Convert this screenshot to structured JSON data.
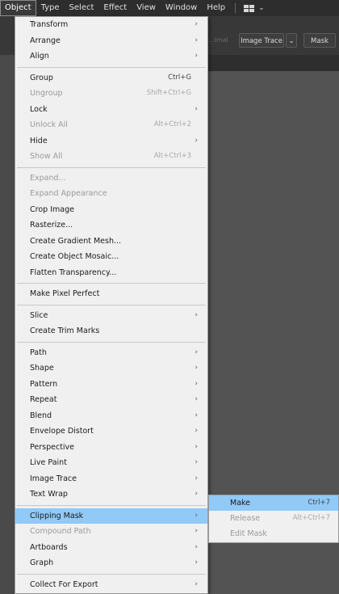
{
  "menubar": {
    "items": [
      "Object",
      "Type",
      "Select",
      "Effect",
      "View",
      "Window",
      "Help"
    ]
  },
  "controlbar": {
    "faded_label": "...imal",
    "image_trace_label": "Image Trace",
    "mask_label": "Mask"
  },
  "object_menu": {
    "items": [
      {
        "label": "Transform",
        "submenu": true
      },
      {
        "label": "Arrange",
        "submenu": true
      },
      {
        "label": "Align",
        "submenu": true
      },
      {
        "sep": true
      },
      {
        "label": "Group",
        "shortcut": "Ctrl+G"
      },
      {
        "label": "Ungroup",
        "shortcut": "Shift+Ctrl+G",
        "disabled": true
      },
      {
        "label": "Lock",
        "submenu": true
      },
      {
        "label": "Unlock All",
        "shortcut": "Alt+Ctrl+2",
        "disabled": true
      },
      {
        "label": "Hide",
        "submenu": true
      },
      {
        "label": "Show All",
        "shortcut": "Alt+Ctrl+3",
        "disabled": true
      },
      {
        "sep": true
      },
      {
        "label": "Expand...",
        "disabled": true
      },
      {
        "label": "Expand Appearance",
        "disabled": true
      },
      {
        "label": "Crop Image"
      },
      {
        "label": "Rasterize..."
      },
      {
        "label": "Create Gradient Mesh..."
      },
      {
        "label": "Create Object Mosaic..."
      },
      {
        "label": "Flatten Transparency..."
      },
      {
        "sep": true
      },
      {
        "label": "Make Pixel Perfect"
      },
      {
        "sep": true
      },
      {
        "label": "Slice",
        "submenu": true
      },
      {
        "label": "Create Trim Marks"
      },
      {
        "sep": true
      },
      {
        "label": "Path",
        "submenu": true
      },
      {
        "label": "Shape",
        "submenu": true
      },
      {
        "label": "Pattern",
        "submenu": true
      },
      {
        "label": "Repeat",
        "submenu": true
      },
      {
        "label": "Blend",
        "submenu": true
      },
      {
        "label": "Envelope Distort",
        "submenu": true
      },
      {
        "label": "Perspective",
        "submenu": true
      },
      {
        "label": "Live Paint",
        "submenu": true
      },
      {
        "label": "Image Trace",
        "submenu": true
      },
      {
        "label": "Text Wrap",
        "submenu": true
      },
      {
        "sep": true
      },
      {
        "label": "Clipping Mask",
        "submenu": true,
        "highlighted": true
      },
      {
        "label": "Compound Path",
        "submenu": true,
        "disabled": true
      },
      {
        "label": "Artboards",
        "submenu": true
      },
      {
        "label": "Graph",
        "submenu": true
      },
      {
        "sep": true
      },
      {
        "label": "Collect For Export",
        "submenu": true
      }
    ]
  },
  "clipping_mask_submenu": {
    "items": [
      {
        "label": "Make",
        "shortcut": "Ctrl+7",
        "highlighted": true
      },
      {
        "label": "Release",
        "shortcut": "Alt+Ctrl+7",
        "disabled": true
      },
      {
        "label": "Edit Mask",
        "disabled": true
      }
    ]
  },
  "colors": {
    "highlight": "#91c9f7",
    "menu_bg": "#f0f0f0",
    "menubar_bg": "#2d2d2d"
  },
  "icons": {
    "submenu_arrow": "chevron-right-icon",
    "workspace_switcher": "grid-icon"
  }
}
